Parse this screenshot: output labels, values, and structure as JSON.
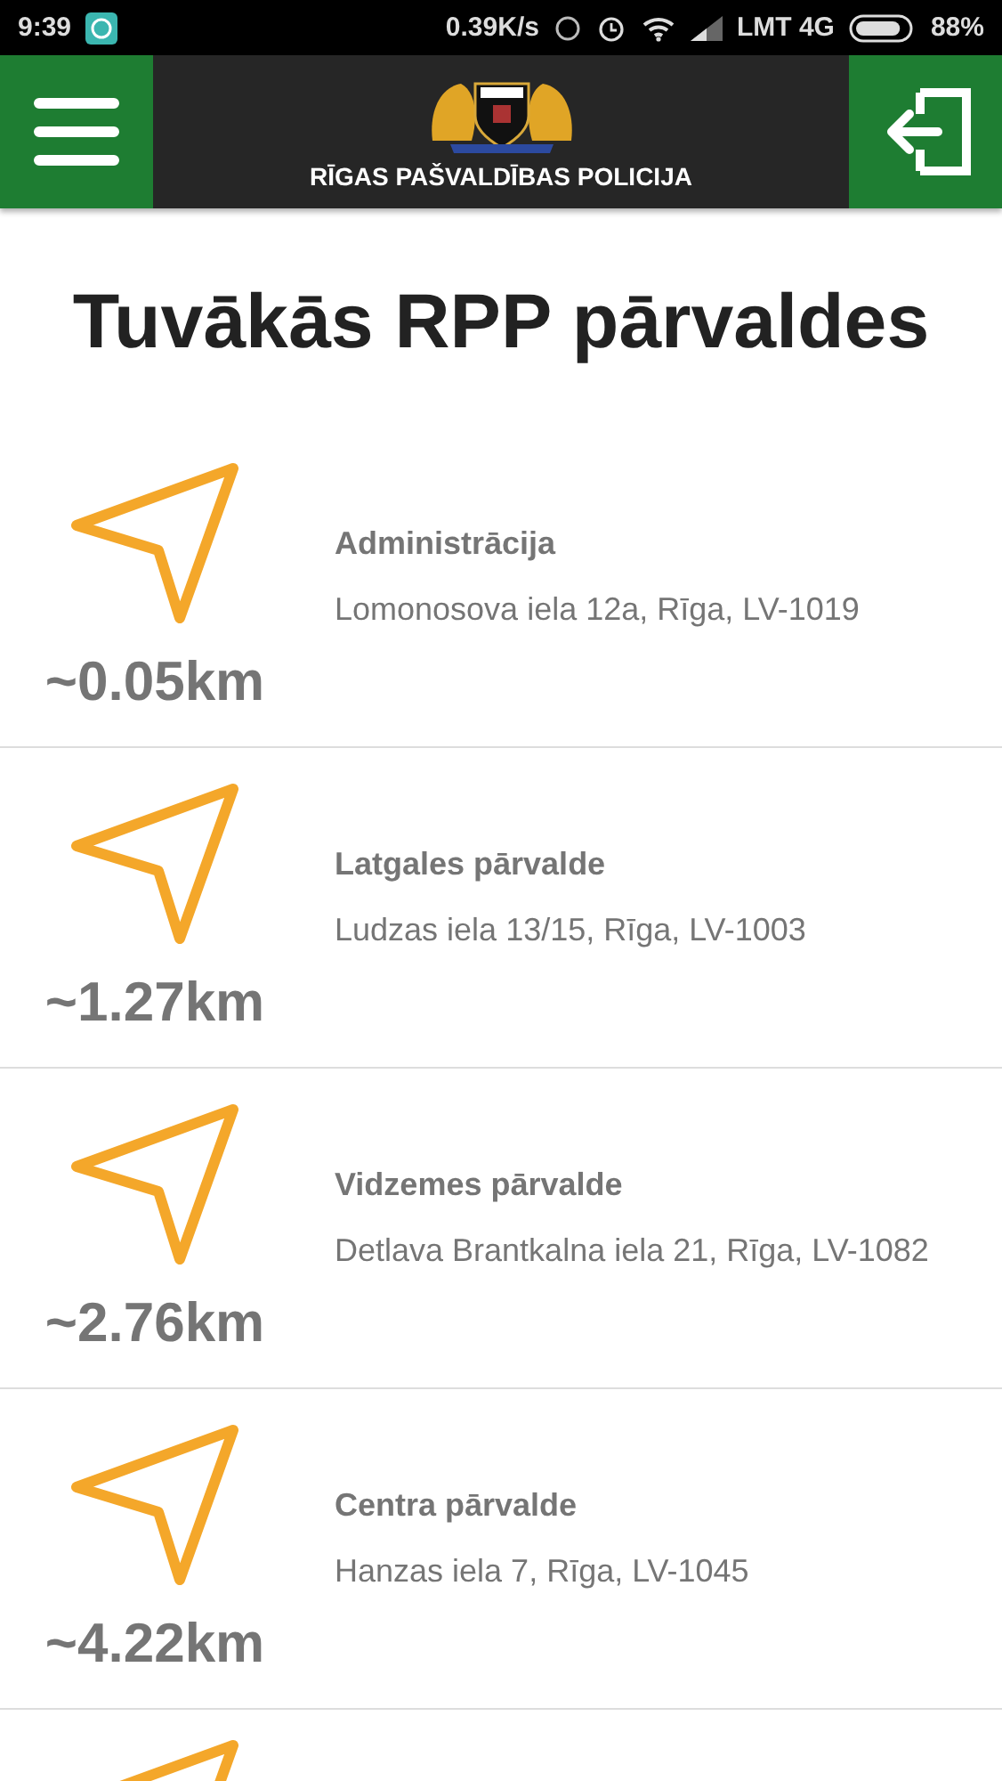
{
  "status_bar": {
    "time": "9:39",
    "speed": "0.39K/s",
    "carrier": "LMT 4G",
    "battery": "88%",
    "battery_meter": {
      "level": 0.88
    }
  },
  "header": {
    "title": "RĪGAS PAŠVALDĪBAS POLICIJA"
  },
  "heading": "Tuvākās RPP pārvaldes",
  "stations": [
    {
      "kind": "full",
      "distance": "~0.05km",
      "name": "Administrācija",
      "address": "Lomonosova iela 12a, Rīga, LV-1019"
    },
    {
      "kind": "full",
      "distance": "~1.27km",
      "name": "Latgales pārvalde",
      "address": "Ludzas iela 13/15, Rīga, LV-1003"
    },
    {
      "kind": "full",
      "distance": "~2.76km",
      "name": "Vidzemes pārvalde",
      "address": "Detlava Brantkalna iela 21, Rīga, LV-1082"
    },
    {
      "kind": "full",
      "distance": "~4.22km",
      "name": "Centra pārvalde",
      "address": "Hanzas iela 7, Rīga, LV-1045"
    },
    {
      "kind": "partial"
    }
  ]
}
